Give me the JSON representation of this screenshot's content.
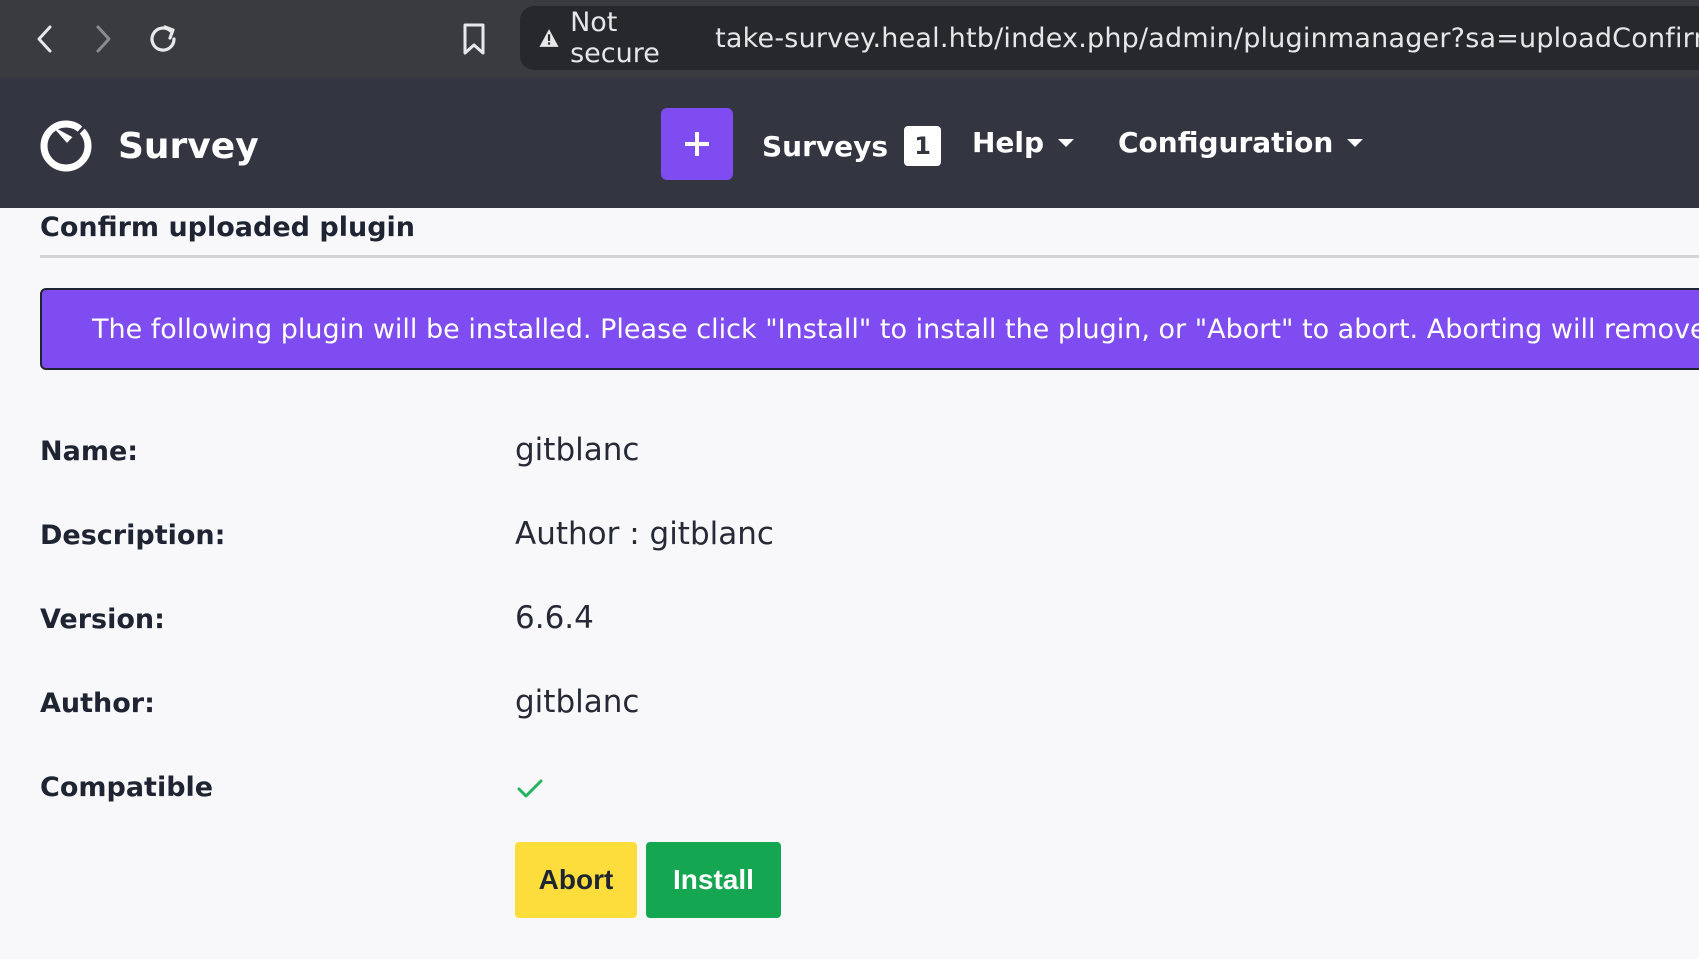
{
  "browser": {
    "security_label": "Not secure",
    "url": "take-survey.heal.htb/index.php/admin/pluginmanager?sa=uploadConfirm"
  },
  "header": {
    "brand_name": "Survey",
    "create_icon": "plus-icon",
    "menu": [
      {
        "label": "Surveys",
        "badge": "1"
      },
      {
        "label": "Help"
      },
      {
        "label": "Configuration"
      }
    ]
  },
  "page": {
    "title": "Confirm uploaded plugin",
    "alert_icon": "bell-icon",
    "alert_text": "The following plugin will be installed. Please click \"Install\" to install the plugin, or \"Abort\" to abort. Aborting will remove the file"
  },
  "plugin": {
    "name_label": "Name:",
    "name_value": "gitblanc",
    "description_label": "Description:",
    "description_value": "Author : gitblanc",
    "version_label": "Version:",
    "version_value": "6.6.4",
    "author_label": "Author:",
    "author_value": "gitblanc",
    "compatible_label": "Compatible",
    "compatible_icon": "checkmark-icon"
  },
  "actions": {
    "abort_label": "Abort",
    "install_label": "Install"
  },
  "colors": {
    "accent": "#7e4cf0",
    "header_bg": "#333641",
    "abort_bg": "#fcdd3c",
    "install_bg": "#14a650",
    "check_color": "#22b45a"
  }
}
